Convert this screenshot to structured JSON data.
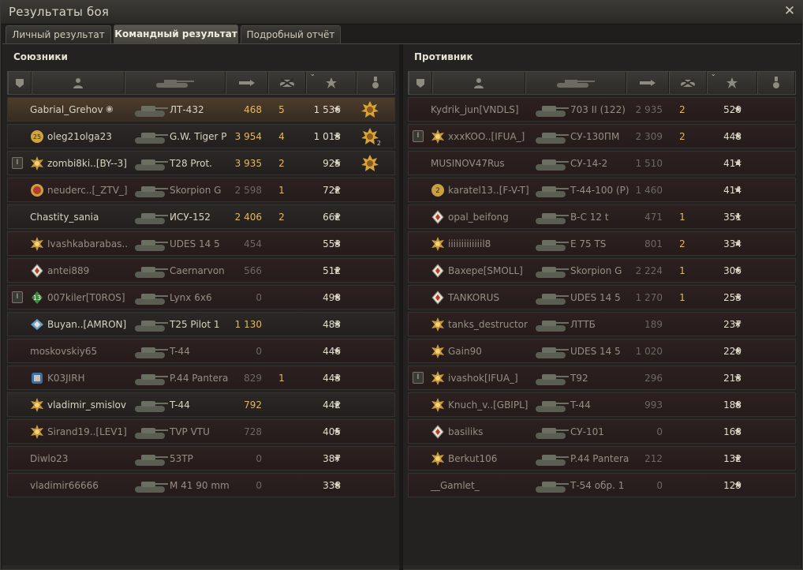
{
  "window": {
    "title": "Результаты боя"
  },
  "tabs": [
    {
      "label": "Личный результат",
      "active": false
    },
    {
      "label": "Командный результат",
      "active": true
    },
    {
      "label": "Подробный отчёт",
      "active": false
    }
  ],
  "allies": {
    "title": "Союзники",
    "rows": [
      {
        "name": "Gabrial_Grehov",
        "tank": "ЛТ-432",
        "damage": "468",
        "kills": "5",
        "xp": "1 536",
        "badge": "",
        "medal": "",
        "award": "gold",
        "award_count": "",
        "state": "me",
        "eye_icon": true
      },
      {
        "name": "oleg21olga23",
        "tank": "G.W. Tiger P",
        "damage": "3 954",
        "kills": "4",
        "xp": "1 013",
        "badge": "",
        "medal": "25",
        "award": "gold",
        "award_count": "2",
        "state": "alive"
      },
      {
        "name": "zombi8ki..[BY--3]",
        "tank": "T28 Prot.",
        "damage": "3 935",
        "kills": "2",
        "xp": "925",
        "badge": "I",
        "medal": "star",
        "award": "gold",
        "award_count": "",
        "state": "alive"
      },
      {
        "name": "neuderc..[_ZTV_]",
        "tank": "Skorpion G",
        "damage": "2 598",
        "kills": "1",
        "xp": "722",
        "badge": "",
        "medal": "red",
        "award": "",
        "award_count": "",
        "state": "dead"
      },
      {
        "name": "Chastity_sania",
        "tank": "ИСУ-152",
        "damage": "2 406",
        "kills": "2",
        "xp": "662",
        "badge": "",
        "medal": "",
        "award": "",
        "award_count": "",
        "state": "alive"
      },
      {
        "name": "Ivashkabarabas..",
        "tank": "UDES 14 5",
        "damage": "454",
        "kills": "",
        "xp": "553",
        "badge": "",
        "medal": "star",
        "award": "",
        "award_count": "",
        "state": "dead"
      },
      {
        "name": "antei889",
        "tank": "Caernarvon",
        "damage": "566",
        "kills": "",
        "xp": "512",
        "badge": "",
        "medal": "diamond",
        "award": "",
        "award_count": "",
        "state": "dead"
      },
      {
        "name": "007kiler[T0ROS]",
        "tank": "Lynx 6x6",
        "damage": "0",
        "kills": "",
        "xp": "498",
        "badge": "I",
        "medal": "13",
        "award": "",
        "award_count": "",
        "state": "dead"
      },
      {
        "name": "Buyan..[AMRON]",
        "tank": "T25 Pilot 1",
        "damage": "1 130",
        "kills": "",
        "xp": "483",
        "badge": "",
        "medal": "wing",
        "award": "",
        "award_count": "",
        "state": "alive"
      },
      {
        "name": "moskovskiy65",
        "tank": "T-44",
        "damage": "0",
        "kills": "",
        "xp": "446",
        "badge": "",
        "medal": "",
        "award": "",
        "award_count": "",
        "state": "dead"
      },
      {
        "name": "K03JIRH",
        "tank": "P.44 Pantera",
        "damage": "829",
        "kills": "1",
        "xp": "443",
        "badge": "",
        "medal": "blue",
        "award": "",
        "award_count": "",
        "state": "dead"
      },
      {
        "name": "vladimir_smislov",
        "tank": "T-44",
        "damage": "792",
        "kills": "",
        "xp": "442",
        "badge": "",
        "medal": "star",
        "award": "",
        "award_count": "",
        "state": "alive"
      },
      {
        "name": "Sirand19..[LEV1]",
        "tank": "TVP VTU",
        "damage": "728",
        "kills": "",
        "xp": "405",
        "badge": "",
        "medal": "star",
        "award": "",
        "award_count": "",
        "state": "dead"
      },
      {
        "name": "Diwlo23",
        "tank": "53TP",
        "damage": "0",
        "kills": "",
        "xp": "387",
        "badge": "",
        "medal": "",
        "award": "",
        "award_count": "",
        "state": "dead"
      },
      {
        "name": "vladimir66666",
        "tank": "M 41 90 mm",
        "damage": "0",
        "kills": "",
        "xp": "338",
        "badge": "",
        "medal": "",
        "award": "",
        "award_count": "",
        "state": "dead"
      }
    ]
  },
  "enemies": {
    "title": "Противник",
    "rows": [
      {
        "name": "Kydrik_jun[VNDLS]",
        "tank": "703 II (122)",
        "damage": "2 935",
        "kills": "2",
        "xp": "520",
        "badge": "",
        "medal": "",
        "state": "dead"
      },
      {
        "name": "xxxKOO..[IFUA_]",
        "tank": "СУ-130ПМ",
        "damage": "2 309",
        "kills": "2",
        "xp": "448",
        "badge": "I",
        "medal": "star",
        "state": "dead"
      },
      {
        "name": "MUSINOV47Rus",
        "tank": "СУ-14-2",
        "damage": "1 510",
        "kills": "",
        "xp": "414",
        "badge": "",
        "medal": "",
        "state": "dead"
      },
      {
        "name": "karatel13..[F-V-T]",
        "tank": "Т-44-100 (Р)",
        "damage": "1 460",
        "kills": "",
        "xp": "414",
        "badge": "",
        "medal": "2",
        "state": "dead"
      },
      {
        "name": "opal_beifong",
        "tank": "В-С 12 t",
        "damage": "471",
        "kills": "1",
        "xp": "351",
        "badge": "",
        "medal": "diamond",
        "state": "dead"
      },
      {
        "name": "iiiiiiiiiiiiil8",
        "tank": "E 75 TS",
        "damage": "801",
        "kills": "2",
        "xp": "334",
        "badge": "",
        "medal": "star",
        "state": "dead"
      },
      {
        "name": "Baxepe[SMOLL]",
        "tank": "Skorpion G",
        "damage": "2 224",
        "kills": "1",
        "xp": "306",
        "badge": "",
        "medal": "diamond",
        "state": "dead"
      },
      {
        "name": "TANKORUS",
        "tank": "UDES 14 5",
        "damage": "1 270",
        "kills": "1",
        "xp": "253",
        "badge": "",
        "medal": "diamond",
        "state": "dead"
      },
      {
        "name": "tanks_destructor",
        "tank": "ЛТТБ",
        "damage": "189",
        "kills": "",
        "xp": "237",
        "badge": "",
        "medal": "star",
        "state": "dead"
      },
      {
        "name": "Gain90",
        "tank": "UDES 14 5",
        "damage": "1 020",
        "kills": "",
        "xp": "220",
        "badge": "",
        "medal": "star",
        "state": "dead"
      },
      {
        "name": "ivashok[IFUA_]",
        "tank": "T92",
        "damage": "296",
        "kills": "",
        "xp": "213",
        "badge": "I",
        "medal": "star",
        "state": "dead"
      },
      {
        "name": "Knuch_v..[GBIPL]",
        "tank": "T-44",
        "damage": "993",
        "kills": "",
        "xp": "188",
        "badge": "",
        "medal": "star",
        "state": "dead"
      },
      {
        "name": "basiliks",
        "tank": "СУ-101",
        "damage": "0",
        "kills": "",
        "xp": "168",
        "badge": "",
        "medal": "diamond",
        "state": "dead"
      },
      {
        "name": "Berkut106",
        "tank": "P.44 Pantera",
        "damage": "212",
        "kills": "",
        "xp": "132",
        "badge": "",
        "medal": "star",
        "state": "dead"
      },
      {
        "name": "__Gamlet_",
        "tank": "Т-54 обр. 1",
        "damage": "0",
        "kills": "",
        "xp": "129",
        "badge": "",
        "medal": "",
        "state": "dead"
      }
    ]
  },
  "colors": {
    "damage": "#e0b868",
    "muted": "#6c6862",
    "text": "#d8d3c3",
    "gold": "#d8a43a"
  }
}
